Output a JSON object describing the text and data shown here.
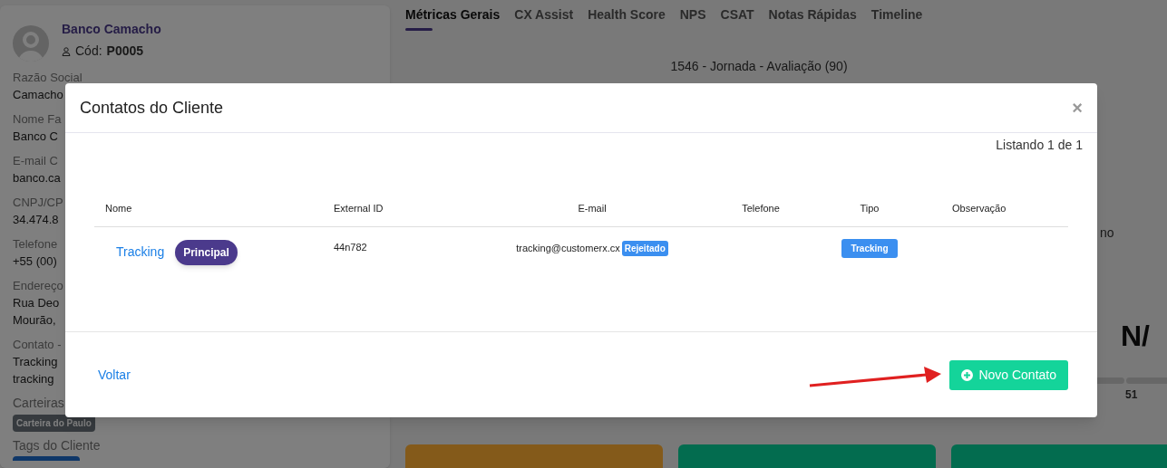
{
  "client": {
    "name": "Banco Camacho",
    "code_label": "Cód:",
    "code": "P0005",
    "fields": [
      {
        "label": "Razão Social",
        "lines": [
          "Camacho"
        ]
      },
      {
        "label": "Nome Fa",
        "lines": [
          "Banco C"
        ]
      },
      {
        "label": "E-mail C",
        "lines": [
          "banco.ca"
        ]
      },
      {
        "label": "CNPJ/CP",
        "lines": [
          "34.474.8"
        ]
      },
      {
        "label": "Telefone",
        "lines": [
          "+55 (00)"
        ]
      },
      {
        "label": "Endereço",
        "lines": [
          "Rua Deo",
          "Mourão, "
        ]
      },
      {
        "label": "Contato -",
        "lines": [
          "Tracking",
          "tracking"
        ]
      }
    ],
    "wallets_label": "Carteiras",
    "wallets": [
      "Carteira do Paulo"
    ],
    "tags_label": "Tags do Cliente"
  },
  "tabs": [
    {
      "label": "Métricas Gerais",
      "selected": true
    },
    {
      "label": "CX Assist",
      "selected": false
    },
    {
      "label": "Health Score",
      "selected": false
    },
    {
      "label": "NPS",
      "selected": false
    },
    {
      "label": "CSAT",
      "selected": false
    },
    {
      "label": "Notas Rápidas",
      "selected": false
    },
    {
      "label": "Timeline",
      "selected": false
    }
  ],
  "journey": {
    "title": "1546 - Jornada - Avaliação (90)"
  },
  "side_text": "no",
  "score": "N/",
  "score_tick": "51",
  "cards": [
    {
      "color": "#845a1a"
    },
    {
      "color": "#036c4f"
    },
    {
      "color": "#036c4f"
    }
  ],
  "modal": {
    "title": "Contatos do Cliente",
    "close": "×",
    "listing": "Listando 1 de 1",
    "columns": [
      "Nome",
      "External ID",
      "E-mail",
      "Telefone",
      "Tipo",
      "Observação"
    ],
    "rows": [
      {
        "name": "Tracking",
        "badge": "Principal",
        "external_id": "44n782",
        "email": "tracking@customerx.cx",
        "email_status": "Rejeitado",
        "type": "Tracking"
      }
    ],
    "back": "Voltar",
    "new_contact": "Novo Contato"
  }
}
